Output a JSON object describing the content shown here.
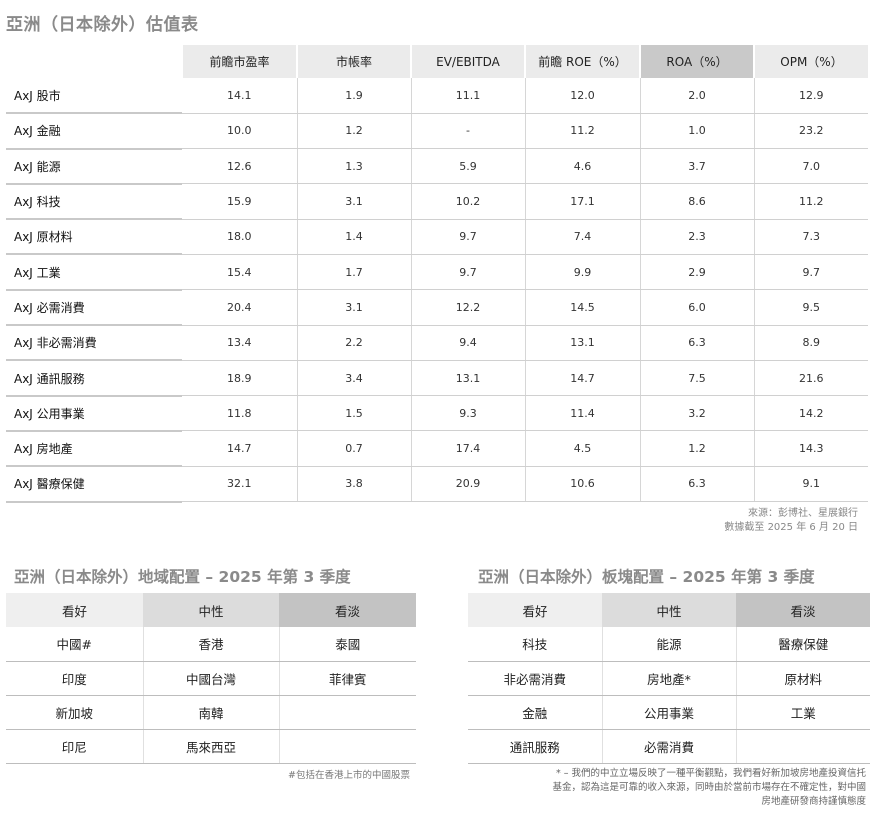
{
  "valuation": {
    "title": "亞洲（日本除外）估值表",
    "columns": [
      "前瞻市盈率",
      "市帳率",
      "EV/EBITDA",
      "前瞻 ROE（%）",
      "ROA（%）",
      "OPM（%）"
    ],
    "rows": [
      {
        "label": "AxJ 股市",
        "values": [
          "14.1",
          "1.9",
          "11.1",
          "12.0",
          "2.0",
          "12.9"
        ]
      },
      {
        "label": "AxJ 金融",
        "values": [
          "10.0",
          "1.2",
          "-",
          "11.2",
          "1.0",
          "23.2"
        ]
      },
      {
        "label": "AxJ 能源",
        "values": [
          "12.6",
          "1.3",
          "5.9",
          "4.6",
          "3.7",
          "7.0"
        ]
      },
      {
        "label": "AxJ 科技",
        "values": [
          "15.9",
          "3.1",
          "10.2",
          "17.1",
          "8.6",
          "11.2"
        ]
      },
      {
        "label": "AxJ 原材料",
        "values": [
          "18.0",
          "1.4",
          "9.7",
          "7.4",
          "2.3",
          "7.3"
        ]
      },
      {
        "label": "AxJ 工業",
        "values": [
          "15.4",
          "1.7",
          "9.7",
          "9.9",
          "2.9",
          "9.7"
        ]
      },
      {
        "label": "AxJ 必需消費",
        "values": [
          "20.4",
          "3.1",
          "12.2",
          "14.5",
          "6.0",
          "9.5"
        ]
      },
      {
        "label": "AxJ 非必需消費",
        "values": [
          "13.4",
          "2.2",
          "9.4",
          "13.1",
          "6.3",
          "8.9"
        ]
      },
      {
        "label": "AxJ 通訊服務",
        "values": [
          "18.9",
          "3.4",
          "13.1",
          "14.7",
          "7.5",
          "21.6"
        ]
      },
      {
        "label": "AxJ 公用事業",
        "values": [
          "11.8",
          "1.5",
          "9.3",
          "11.4",
          "3.2",
          "14.2"
        ]
      },
      {
        "label": "AxJ 房地產",
        "values": [
          "14.7",
          "0.7",
          "17.4",
          "4.5",
          "1.2",
          "14.3"
        ]
      },
      {
        "label": "AxJ 醫療保健",
        "values": [
          "32.1",
          "3.8",
          "20.9",
          "10.6",
          "6.3",
          "9.1"
        ]
      }
    ],
    "source_line1": "來源：彭博社、星展銀行",
    "source_line2": "數據截至 2025 年 6 月 20 日"
  },
  "regional": {
    "title": "亞洲（日本除外）地域配置 – 2025 年第 3 季度",
    "headers": [
      "看好",
      "中性",
      "看淡"
    ],
    "rows": [
      [
        "中國#",
        "香港",
        "泰國"
      ],
      [
        "印度",
        "中國台灣",
        "菲律賓"
      ],
      [
        "新加坡",
        "南韓",
        ""
      ],
      [
        "印尼",
        "馬來西亞",
        ""
      ]
    ],
    "note": "#包括在香港上市的中國股票"
  },
  "sector": {
    "title": "亞洲（日本除外）板塊配置 – 2025 年第 3 季度",
    "headers": [
      "看好",
      "中性",
      "看淡"
    ],
    "rows": [
      [
        "科技",
        "能源",
        "醫療保健"
      ],
      [
        "非必需消費",
        "房地產*",
        "原材料"
      ],
      [
        "金融",
        "公用事業",
        "工業"
      ],
      [
        "通訊服務",
        "必需消費",
        ""
      ]
    ],
    "note_line1": "* – 我們的中立立場反映了一種平衡觀點，我們看好新加坡房地產投資信托",
    "note_line2": "基金，認為這是可靠的收入來源，同時由於當前市場存在不確定性，對中國",
    "note_line3": "房地產研發商持謹慎態度"
  }
}
